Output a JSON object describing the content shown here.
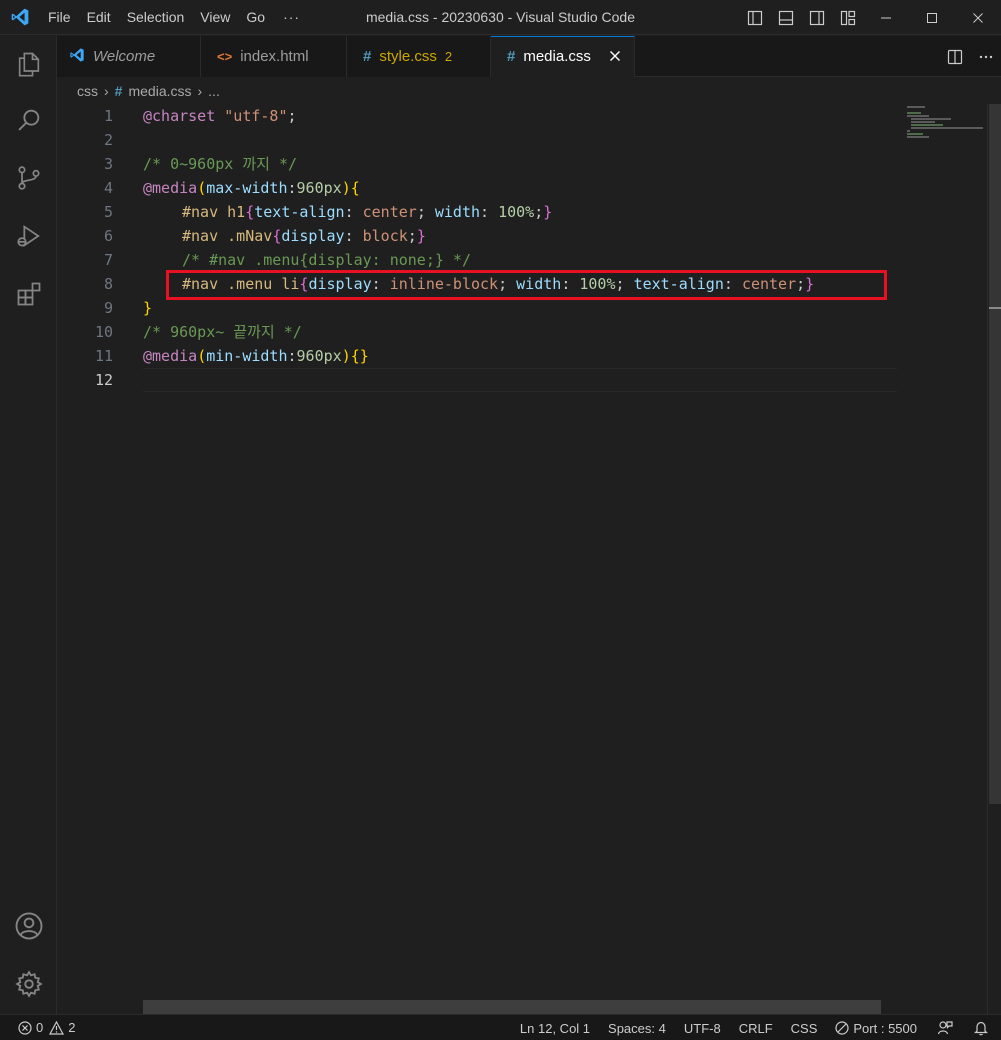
{
  "titlebar": {
    "menu": [
      "File",
      "Edit",
      "Selection",
      "View",
      "Go"
    ],
    "more": "···",
    "title": "media.css - 20230630 - Visual Studio Code"
  },
  "tabs": [
    {
      "label": "Welcome",
      "icon": "vscode-icon",
      "italic": true
    },
    {
      "label": "index.html",
      "icon": "html-icon",
      "italic": false
    },
    {
      "label": "style.css",
      "icon": "css-hash-icon",
      "badge": "2",
      "modified_color": "#cca700"
    },
    {
      "label": "media.css",
      "icon": "css-hash-icon",
      "active": true
    }
  ],
  "breadcrumb": {
    "folder": "css",
    "file": "media.css",
    "more": "..."
  },
  "editor": {
    "line_numbers": [
      "1",
      "2",
      "3",
      "4",
      "5",
      "6",
      "7",
      "8",
      "9",
      "10",
      "11",
      "12"
    ],
    "current_line": "12",
    "lines": {
      "l1_at": "@charset",
      "l1_str": "\"utf-8\"",
      "l1_semi": ";",
      "l3_comment": "/* 0~960px 까지 */",
      "l4_at": "@media",
      "l4_open": "(",
      "l4_prop": "max-width",
      "l4_colon": ":",
      "l4_num": "960px",
      "l4_close": ")",
      "l4_brace": "{",
      "l5_sel": "#nav h1",
      "l5_open": "{",
      "l5_p1": "text-align",
      "l5_c1": ": ",
      "l5_v1": "center",
      "l5_s1": "; ",
      "l5_p2": "width",
      "l5_c2": ": ",
      "l5_v2": "100%",
      "l5_s2": ";",
      "l5_close": "}",
      "l6_sel": "#nav .mNav",
      "l6_open": "{",
      "l6_p1": "display",
      "l6_c1": ": ",
      "l6_v1": "block",
      "l6_s1": ";",
      "l6_close": "}",
      "l7_comment": "/* #nav .menu{display: none;} */",
      "l8_sel": "#nav .menu li",
      "l8_open": "{",
      "l8_p1": "display",
      "l8_c1": ": ",
      "l8_v1": "inline-block",
      "l8_s1": "; ",
      "l8_p2": "width",
      "l8_c2": ": ",
      "l8_v2": "100%",
      "l8_s2": "; ",
      "l8_p3": "text-align",
      "l8_c3": ": ",
      "l8_v3": "center",
      "l8_s3": ";",
      "l8_close": "}",
      "l9_brace": "}",
      "l10_comment": "/* 960px~ 끝까지 */",
      "l11_at": "@media",
      "l11_open": "(",
      "l11_prop": "min-width",
      "l11_colon": ":",
      "l11_num": "960px",
      "l11_close": ")",
      "l11_braces": "{}"
    },
    "highlight_color": "#e81123"
  },
  "statusbar": {
    "errors": "0",
    "warnings": "2",
    "position": "Ln 12, Col 1",
    "spaces": "Spaces: 4",
    "encoding": "UTF-8",
    "eol": "CRLF",
    "language": "CSS",
    "port": "Port : 5500"
  },
  "colors": {
    "accent": "#0078d4",
    "vscode_blue": "#3ca7f5",
    "html_orange": "#e37933",
    "css_hash": "#519aba"
  }
}
